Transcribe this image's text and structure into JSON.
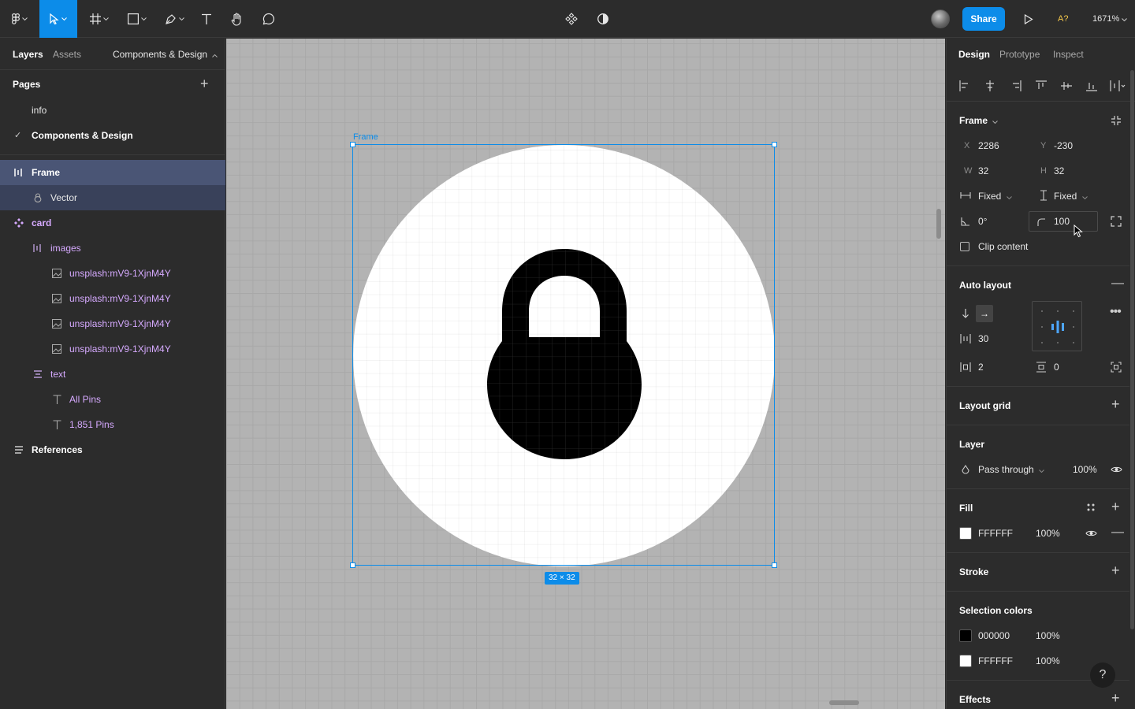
{
  "toolbar": {
    "share_label": "Share",
    "user_badge": "A?",
    "zoom": "1671%"
  },
  "left_panel": {
    "tabs": [
      {
        "label": "Layers"
      },
      {
        "label": "Assets"
      },
      {
        "label": "Components & Design"
      }
    ],
    "pages_title": "Pages",
    "pages": [
      {
        "label": "info"
      },
      {
        "label": "Components & Design"
      }
    ],
    "layers": [
      {
        "label": "Frame"
      },
      {
        "label": "Vector"
      },
      {
        "label": "card"
      },
      {
        "label": "images"
      },
      {
        "label": "unsplash:mV9-1XjnM4Y"
      },
      {
        "label": "unsplash:mV9-1XjnM4Y"
      },
      {
        "label": "unsplash:mV9-1XjnM4Y"
      },
      {
        "label": "unsplash:mV9-1XjnM4Y"
      },
      {
        "label": "text"
      },
      {
        "label": "All Pins"
      },
      {
        "label": "1,851 Pins"
      },
      {
        "label": "References"
      }
    ]
  },
  "canvas": {
    "frame_label": "Frame",
    "size_badge": "32 × 32"
  },
  "right_panel": {
    "tabs": [
      {
        "label": "Design"
      },
      {
        "label": "Prototype"
      },
      {
        "label": "Inspect"
      }
    ],
    "frame": {
      "title": "Frame",
      "x_label": "X",
      "x": "2286",
      "y_label": "Y",
      "y": "-230",
      "w_label": "W",
      "w": "32",
      "h_label": "H",
      "h": "32",
      "h_sizing": "Fixed",
      "v_sizing": "Fixed",
      "rotation": "0°",
      "radius": "100",
      "clip_content": "Clip content"
    },
    "auto_layout": {
      "title": "Auto layout",
      "spacing": "30",
      "padding_h": "2",
      "padding_v": "0"
    },
    "layout_grid": {
      "title": "Layout grid"
    },
    "layer": {
      "title": "Layer",
      "blend": "Pass through",
      "opacity": "100%"
    },
    "fill": {
      "title": "Fill",
      "color": "FFFFFF",
      "opacity": "100%"
    },
    "stroke": {
      "title": "Stroke"
    },
    "selection_colors": {
      "title": "Selection colors",
      "items": [
        {
          "color": "000000",
          "opacity": "100%"
        },
        {
          "color": "FFFFFF",
          "opacity": "100%"
        }
      ]
    },
    "effects": {
      "title": "Effects"
    },
    "help": "?"
  },
  "colors": {
    "accent": "#0c8ce9",
    "component": "#d6aaff",
    "panel": "#2c2c2c"
  }
}
